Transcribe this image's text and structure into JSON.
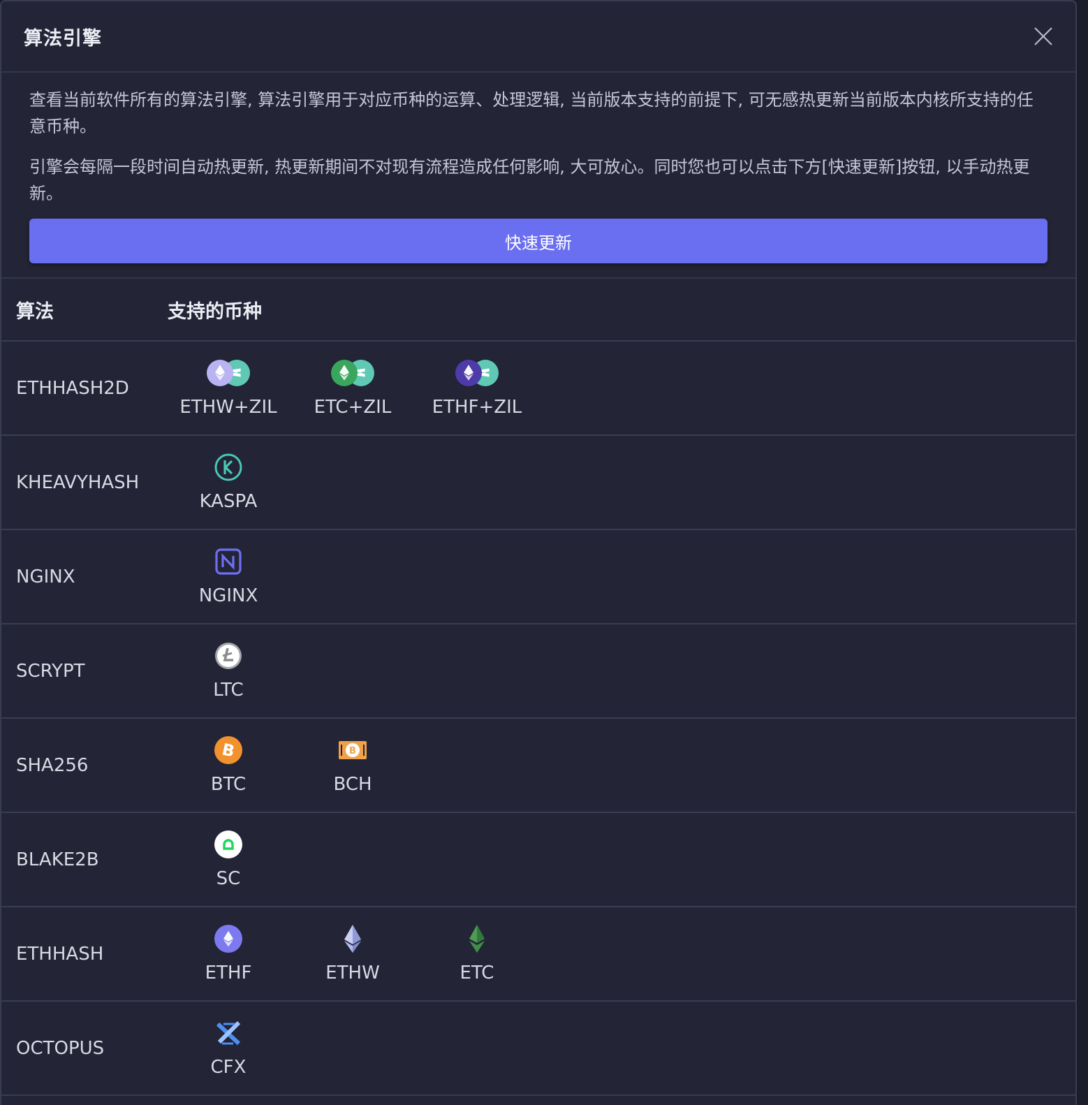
{
  "dialog": {
    "title": "算法引擎",
    "description_1": "查看当前软件所有的算法引擎, 算法引擎用于对应币种的运算、处理逻辑, 当前版本支持的前提下, 可无感热更新当前版本内核所支持的任意币种。",
    "description_2": "引擎会每隔一段时间自动热更新, 热更新期间不对现有流程造成任何影响, 大可放心。同时您也可以点击下方[快速更新]按钮, 以手动热更新。",
    "update_button": "快速更新"
  },
  "table": {
    "col_algorithm": "算法",
    "col_coins": "支持的币种",
    "rows": [
      {
        "algorithm": "ETHHASH2D",
        "coins": [
          {
            "label": "ETHW+ZIL",
            "icon": "ethw-zil-icon"
          },
          {
            "label": "ETC+ZIL",
            "icon": "etc-zil-icon"
          },
          {
            "label": "ETHF+ZIL",
            "icon": "ethf-zil-icon"
          }
        ]
      },
      {
        "algorithm": "KHEAVYHASH",
        "coins": [
          {
            "label": "KASPA",
            "icon": "kaspa-icon"
          }
        ]
      },
      {
        "algorithm": "NGINX",
        "coins": [
          {
            "label": "NGINX",
            "icon": "nginx-icon"
          }
        ]
      },
      {
        "algorithm": "SCRYPT",
        "coins": [
          {
            "label": "LTC",
            "icon": "ltc-icon"
          }
        ]
      },
      {
        "algorithm": "SHA256",
        "coins": [
          {
            "label": "BTC",
            "icon": "btc-icon"
          },
          {
            "label": "BCH",
            "icon": "bch-icon"
          }
        ]
      },
      {
        "algorithm": "BLAKE2B",
        "coins": [
          {
            "label": "SC",
            "icon": "sc-icon"
          }
        ]
      },
      {
        "algorithm": "ETHHASH",
        "coins": [
          {
            "label": "ETHF",
            "icon": "ethf-icon"
          },
          {
            "label": "ETHW",
            "icon": "ethw-icon"
          },
          {
            "label": "ETC",
            "icon": "etc-icon"
          }
        ]
      },
      {
        "algorithm": "OCTOPUS",
        "coins": [
          {
            "label": "CFX",
            "icon": "cfx-icon"
          }
        ]
      }
    ]
  },
  "colors": {
    "background": "#232436",
    "accent": "#6a6ef0",
    "divider": "#3a3c52"
  }
}
